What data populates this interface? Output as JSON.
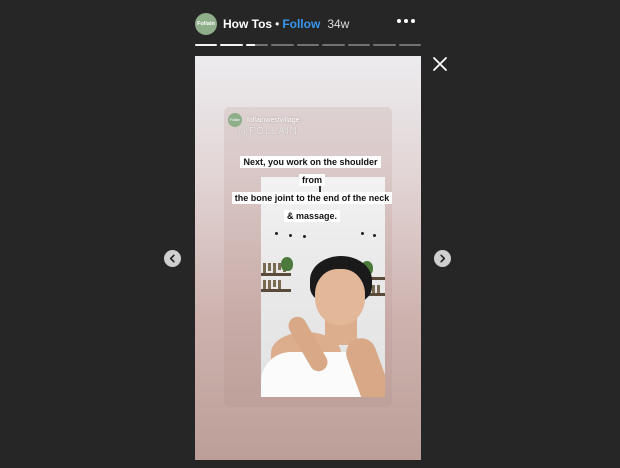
{
  "header": {
    "avatar_text": "Follain",
    "account": "How Tos",
    "separator": "•",
    "follow_label": "Follow",
    "age": "34w"
  },
  "progress": {
    "total_segments": 9,
    "completed_segments": 2,
    "current_fraction": 0.4
  },
  "story": {
    "card_avatar_text": "Follain",
    "card_account": "follainwestvillage",
    "handle": "@FOLLAIN",
    "caption_lines": [
      "Next, you work on the shoulder from",
      "the bone joint to the end of the neck",
      "& massage."
    ]
  },
  "icons": {
    "more": "more-horizontal-icon",
    "close": "close-icon",
    "prev": "chevron-left-icon",
    "next": "chevron-right-icon"
  },
  "colors": {
    "background": "#262626",
    "follow": "#3897f0",
    "avatar": "#8fae8a"
  }
}
